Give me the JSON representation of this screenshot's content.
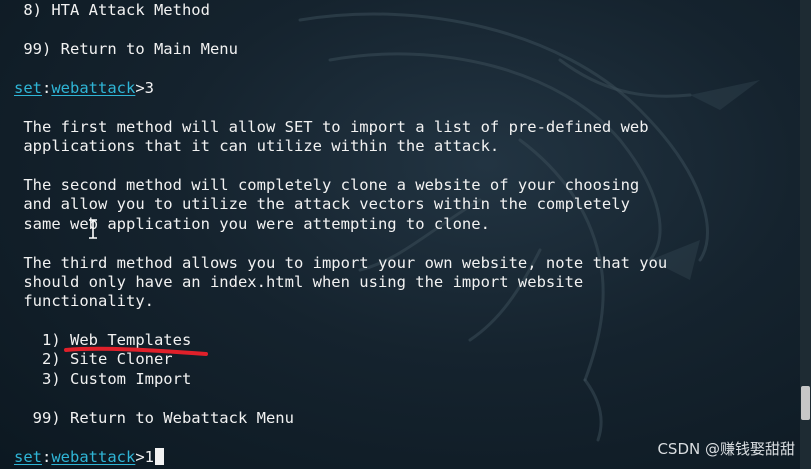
{
  "terminal": {
    "menu_item_8": " 8) HTA Attack Method",
    "menu_item_99": " 99) Return to Main Menu",
    "prompt1": {
      "set": "set",
      "sep": ":",
      "module": "webattack",
      "suffix": ">3"
    },
    "para1_line1": " The first method will allow SET to import a list of pre-defined web",
    "para1_line2": " applications that it can utilize within the attack.",
    "para2_line1": " The second method will completely clone a website of your choosing",
    "para2_line2": " and allow you to utilize the attack vectors within the completely",
    "para2_line3": " same web application you were attempting to clone.",
    "para3_line1": " The third method allows you to import your own website, note that you",
    "para3_line2": " should only have an index.html when using the import website",
    "para3_line3": " functionality.",
    "option_1": "   1) Web Templates",
    "option_2": "   2) Site Cloner",
    "option_3": "   3) Custom Import",
    "option_99": "  99) Return to Webattack Menu",
    "prompt2": {
      "set": "set",
      "sep": ":",
      "module": "webattack",
      "suffix": ">1"
    }
  },
  "watermark": "CSDN @赚钱娶甜甜",
  "colors": {
    "background": "#15232e",
    "text": "#f2f2f2",
    "prompt": "#2fb5d6",
    "annotation_red": "#e0202a"
  },
  "icons": {
    "text_cursor": "i-beam-cursor-icon",
    "background_logo": "kali-dragon-icon"
  }
}
